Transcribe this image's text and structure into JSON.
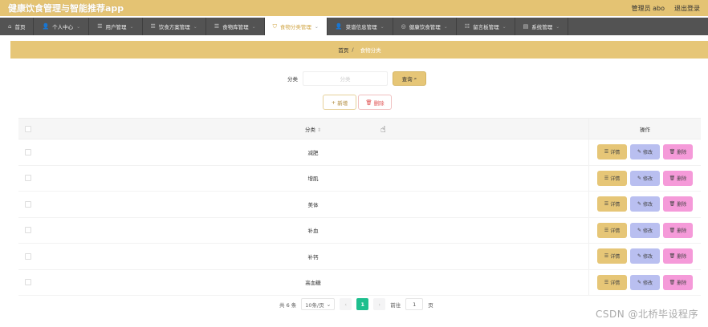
{
  "header": {
    "app_title": "健康饮食管理与智能推荐app",
    "user": "管理员 abo",
    "logout": "退出登录"
  },
  "nav": {
    "items": [
      {
        "label": "首页",
        "icon": "home-icon",
        "glyph": "⌂",
        "active": false,
        "has_menu": false
      },
      {
        "label": "个人中心",
        "icon": "person-icon",
        "glyph": "👤",
        "active": false,
        "has_menu": true
      },
      {
        "label": "用户管理",
        "icon": "user-manage-icon",
        "glyph": "☰",
        "active": false,
        "has_menu": true
      },
      {
        "label": "饮食方案管理",
        "icon": "plan-icon",
        "glyph": "☰",
        "active": false,
        "has_menu": true
      },
      {
        "label": "食物库管理",
        "icon": "food-library-icon",
        "glyph": "☰",
        "active": false,
        "has_menu": true
      },
      {
        "label": "食物分类管理",
        "icon": "food-category-icon",
        "glyph": "⛉",
        "active": true,
        "has_menu": true
      },
      {
        "label": "菜谱信息管理",
        "icon": "recipe-icon",
        "glyph": "👤",
        "active": false,
        "has_menu": true
      },
      {
        "label": "健康饮食管理",
        "icon": "health-icon",
        "glyph": "◎",
        "active": false,
        "has_menu": true
      },
      {
        "label": "留言板管理",
        "icon": "message-board-icon",
        "glyph": "☷",
        "active": false,
        "has_menu": true
      },
      {
        "label": "系统管理",
        "icon": "system-icon",
        "glyph": "▤",
        "active": false,
        "has_menu": true
      }
    ]
  },
  "breadcrumb": {
    "home": "首页",
    "separator": "/",
    "current": "食物分类"
  },
  "search": {
    "label": "分类",
    "placeholder": "分类",
    "button": "查询"
  },
  "actions": {
    "add": "新增",
    "delete": "删除"
  },
  "table": {
    "col_name": "分类",
    "col_ops": "操作",
    "rows": [
      "减肥",
      "增肌",
      "美体",
      "补血",
      "补钙",
      "高血糖"
    ],
    "op_detail": "详情",
    "op_edit": "修改",
    "op_delete": "删除"
  },
  "pagination": {
    "total": "共 6 条",
    "page_size": "10条/页",
    "current_page": "1",
    "goto_label": "前往",
    "goto_value": "1",
    "page_suffix": "页"
  },
  "watermark": "CSDN @北桥毕设程序",
  "colors": {
    "accent": "#e4c373",
    "nav_bg": "#535353",
    "page_active": "#1ebf8e",
    "op_edit": "#b9bff0",
    "op_delete": "#f59ad9"
  }
}
